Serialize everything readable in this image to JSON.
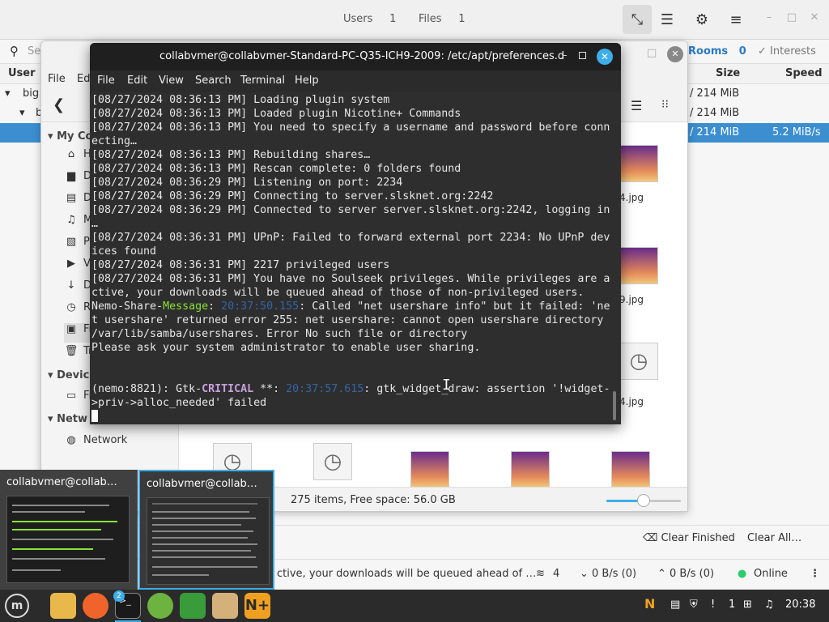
{
  "nicotine": {
    "tabs": [
      {
        "label": "Users",
        "count": "1"
      },
      {
        "label": "Files",
        "count": "1"
      }
    ],
    "subtabs": {
      "search_placeholder": "Se",
      "rooms": "Rooms",
      "rooms_count": "0",
      "interests": "Interests"
    },
    "columns": {
      "user": "User",
      "size": "Size",
      "speed": "Speed"
    },
    "rows": [
      {
        "user": "big",
        "size": "/ 214 MiB",
        "speed": ""
      },
      {
        "user": "b",
        "size": "/ 214 MiB",
        "speed": ""
      },
      {
        "user": "",
        "size": "/ 214 MiB",
        "speed": "5.2 MiB/s"
      }
    ],
    "bottom": {
      "clear_finished": "Clear Finished",
      "clear_all": "Clear All…"
    },
    "status": {
      "message": "ctive, your downloads will be queued ahead of …",
      "connections": "4",
      "down": "0 B/s (0)",
      "up": "0 B/s (0)",
      "online": "Online"
    }
  },
  "nemo": {
    "menu": [
      "File",
      "Ed"
    ],
    "sidebar": {
      "my_computer": "My Co",
      "items": [
        {
          "icon": "home-icon",
          "glyph": "⌂",
          "label": "H"
        },
        {
          "icon": "desktop-icon",
          "glyph": "▆",
          "label": "D"
        },
        {
          "icon": "documents-icon",
          "glyph": "▤",
          "label": "D"
        },
        {
          "icon": "music-icon",
          "glyph": "♫",
          "label": "M"
        },
        {
          "icon": "pictures-icon",
          "glyph": "▧",
          "label": "Pi"
        },
        {
          "icon": "videos-icon",
          "glyph": "▶",
          "label": "Vi"
        },
        {
          "icon": "downloads-icon",
          "glyph": "↓",
          "label": "D"
        },
        {
          "icon": "recent-icon",
          "glyph": "◷",
          "label": "Re"
        },
        {
          "icon": "filesystem-icon",
          "glyph": "▣",
          "label": "Fi"
        },
        {
          "icon": "trash-icon",
          "glyph": "🗑",
          "label": "Tr"
        }
      ],
      "devices": "Devic",
      "device_item": "Fi",
      "network_header": "Netw",
      "network_item": "Network"
    },
    "files": [
      "4.jpg",
      "9.jpg",
      "4.jpg"
    ],
    "status": "275 items, Free space: 56.0 GB"
  },
  "terminal": {
    "title": "collabvmer@collabvmer-Standard-PC-Q35-ICH9-2009: /etc/apt/preferences.d",
    "menu": [
      "File",
      "Edit",
      "View",
      "Search",
      "Terminal",
      "Help"
    ],
    "lines": [
      "[08/27/2024 08:36:13 PM] Loading plugin system",
      "[08/27/2024 08:36:13 PM] Loaded plugin Nicotine+ Commands",
      "[08/27/2024 08:36:13 PM] You need to specify a username and password before conn",
      "ecting…",
      "[08/27/2024 08:36:13 PM] Rebuilding shares…",
      "[08/27/2024 08:36:13 PM] Rescan complete: 0 folders found",
      "[08/27/2024 08:36:29 PM] Listening on port: 2234",
      "[08/27/2024 08:36:29 PM] Connecting to server.slsknet.org:2242",
      "[08/27/2024 08:36:29 PM] Connected to server server.slsknet.org:2242, logging in",
      "…",
      "[08/27/2024 08:36:31 PM] UPnP: Failed to forward external port 2234: No UPnP dev",
      "ices found",
      "[08/27/2024 08:36:31 PM] 2217 privileged users",
      "[08/27/2024 08:36:31 PM] You have no Soulseek privileges. While privileges are a",
      "ctive, your downloads will be queued ahead of those of non-privileged users."
    ],
    "nemo_msg": {
      "prefix": "Nemo-Share-",
      "tag": "Message",
      "time": "20:37:50.155",
      "rest1": ": Called \"net usershare info\" but it failed: 'ne",
      "line2": "t usershare' returned error 255: net usershare: cannot open usershare directory",
      "line3": "/var/lib/samba/usershares. Error No such file or directory",
      "line4": "Please ask your system administrator to enable user sharing."
    },
    "gtk_msg": {
      "prefix": "(nemo:8821): Gtk-",
      "tag": "CRITICAL",
      "mid": " **: ",
      "time": "20:37:57.615",
      "rest1": ": gtk_widget_draw: assertion '!widget-",
      "line2": ">priv->alloc_needed' failed"
    }
  },
  "alt_tab": [
    "collabvmer@collab…",
    "collabvmer@collab…"
  ],
  "taskbar": {
    "terminal_badge": "2",
    "notif_count": "1",
    "clock": "20:38"
  }
}
